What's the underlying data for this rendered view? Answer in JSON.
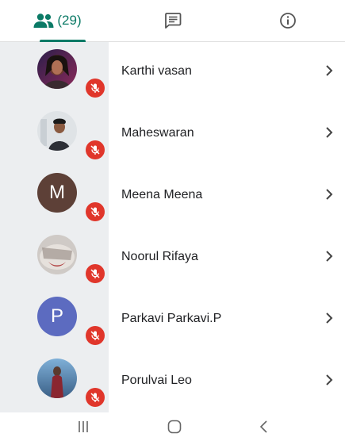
{
  "tabs": {
    "people": {
      "icon": "people-icon",
      "count": "(29)",
      "selected": true
    },
    "chat": {
      "icon": "chat-icon"
    },
    "info": {
      "icon": "info-icon"
    },
    "accent": "#0b7a66"
  },
  "participants": [
    {
      "name": "Karthi vasan",
      "avatar": "photo",
      "muted": true
    },
    {
      "name": "Maheswaran",
      "avatar": "photo",
      "muted": true
    },
    {
      "name": "Meena Meena",
      "avatar": "letter",
      "letter": "M",
      "avatar_color": "#5d4037",
      "muted": true
    },
    {
      "name": "Noorul Rifaya",
      "avatar": "photo",
      "muted": true
    },
    {
      "name": "Parkavi Parkavi.P",
      "avatar": "letter",
      "letter": "P",
      "avatar_color": "#5c6bc0",
      "muted": true
    },
    {
      "name": "Porulvai Leo",
      "avatar": "photo",
      "muted": true
    }
  ],
  "mute_color": "#e0362b",
  "navigation": {
    "recents": "recents-icon",
    "home": "home-icon",
    "back": "back-icon"
  }
}
